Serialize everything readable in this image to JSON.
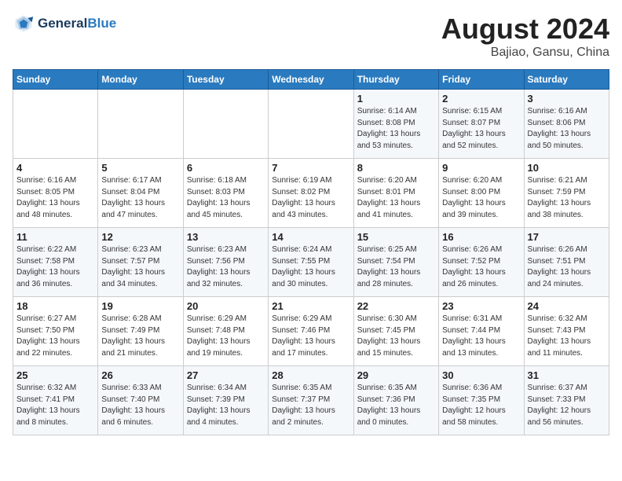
{
  "header": {
    "logo_line1": "General",
    "logo_line2": "Blue",
    "month": "August 2024",
    "location": "Bajiao, Gansu, China"
  },
  "weekdays": [
    "Sunday",
    "Monday",
    "Tuesday",
    "Wednesday",
    "Thursday",
    "Friday",
    "Saturday"
  ],
  "weeks": [
    [
      {
        "day": "",
        "info": ""
      },
      {
        "day": "",
        "info": ""
      },
      {
        "day": "",
        "info": ""
      },
      {
        "day": "",
        "info": ""
      },
      {
        "day": "1",
        "info": "Sunrise: 6:14 AM\nSunset: 8:08 PM\nDaylight: 13 hours\nand 53 minutes."
      },
      {
        "day": "2",
        "info": "Sunrise: 6:15 AM\nSunset: 8:07 PM\nDaylight: 13 hours\nand 52 minutes."
      },
      {
        "day": "3",
        "info": "Sunrise: 6:16 AM\nSunset: 8:06 PM\nDaylight: 13 hours\nand 50 minutes."
      }
    ],
    [
      {
        "day": "4",
        "info": "Sunrise: 6:16 AM\nSunset: 8:05 PM\nDaylight: 13 hours\nand 48 minutes."
      },
      {
        "day": "5",
        "info": "Sunrise: 6:17 AM\nSunset: 8:04 PM\nDaylight: 13 hours\nand 47 minutes."
      },
      {
        "day": "6",
        "info": "Sunrise: 6:18 AM\nSunset: 8:03 PM\nDaylight: 13 hours\nand 45 minutes."
      },
      {
        "day": "7",
        "info": "Sunrise: 6:19 AM\nSunset: 8:02 PM\nDaylight: 13 hours\nand 43 minutes."
      },
      {
        "day": "8",
        "info": "Sunrise: 6:20 AM\nSunset: 8:01 PM\nDaylight: 13 hours\nand 41 minutes."
      },
      {
        "day": "9",
        "info": "Sunrise: 6:20 AM\nSunset: 8:00 PM\nDaylight: 13 hours\nand 39 minutes."
      },
      {
        "day": "10",
        "info": "Sunrise: 6:21 AM\nSunset: 7:59 PM\nDaylight: 13 hours\nand 38 minutes."
      }
    ],
    [
      {
        "day": "11",
        "info": "Sunrise: 6:22 AM\nSunset: 7:58 PM\nDaylight: 13 hours\nand 36 minutes."
      },
      {
        "day": "12",
        "info": "Sunrise: 6:23 AM\nSunset: 7:57 PM\nDaylight: 13 hours\nand 34 minutes."
      },
      {
        "day": "13",
        "info": "Sunrise: 6:23 AM\nSunset: 7:56 PM\nDaylight: 13 hours\nand 32 minutes."
      },
      {
        "day": "14",
        "info": "Sunrise: 6:24 AM\nSunset: 7:55 PM\nDaylight: 13 hours\nand 30 minutes."
      },
      {
        "day": "15",
        "info": "Sunrise: 6:25 AM\nSunset: 7:54 PM\nDaylight: 13 hours\nand 28 minutes."
      },
      {
        "day": "16",
        "info": "Sunrise: 6:26 AM\nSunset: 7:52 PM\nDaylight: 13 hours\nand 26 minutes."
      },
      {
        "day": "17",
        "info": "Sunrise: 6:26 AM\nSunset: 7:51 PM\nDaylight: 13 hours\nand 24 minutes."
      }
    ],
    [
      {
        "day": "18",
        "info": "Sunrise: 6:27 AM\nSunset: 7:50 PM\nDaylight: 13 hours\nand 22 minutes."
      },
      {
        "day": "19",
        "info": "Sunrise: 6:28 AM\nSunset: 7:49 PM\nDaylight: 13 hours\nand 21 minutes."
      },
      {
        "day": "20",
        "info": "Sunrise: 6:29 AM\nSunset: 7:48 PM\nDaylight: 13 hours\nand 19 minutes."
      },
      {
        "day": "21",
        "info": "Sunrise: 6:29 AM\nSunset: 7:46 PM\nDaylight: 13 hours\nand 17 minutes."
      },
      {
        "day": "22",
        "info": "Sunrise: 6:30 AM\nSunset: 7:45 PM\nDaylight: 13 hours\nand 15 minutes."
      },
      {
        "day": "23",
        "info": "Sunrise: 6:31 AM\nSunset: 7:44 PM\nDaylight: 13 hours\nand 13 minutes."
      },
      {
        "day": "24",
        "info": "Sunrise: 6:32 AM\nSunset: 7:43 PM\nDaylight: 13 hours\nand 11 minutes."
      }
    ],
    [
      {
        "day": "25",
        "info": "Sunrise: 6:32 AM\nSunset: 7:41 PM\nDaylight: 13 hours\nand 8 minutes."
      },
      {
        "day": "26",
        "info": "Sunrise: 6:33 AM\nSunset: 7:40 PM\nDaylight: 13 hours\nand 6 minutes."
      },
      {
        "day": "27",
        "info": "Sunrise: 6:34 AM\nSunset: 7:39 PM\nDaylight: 13 hours\nand 4 minutes."
      },
      {
        "day": "28",
        "info": "Sunrise: 6:35 AM\nSunset: 7:37 PM\nDaylight: 13 hours\nand 2 minutes."
      },
      {
        "day": "29",
        "info": "Sunrise: 6:35 AM\nSunset: 7:36 PM\nDaylight: 13 hours\nand 0 minutes."
      },
      {
        "day": "30",
        "info": "Sunrise: 6:36 AM\nSunset: 7:35 PM\nDaylight: 12 hours\nand 58 minutes."
      },
      {
        "day": "31",
        "info": "Sunrise: 6:37 AM\nSunset: 7:33 PM\nDaylight: 12 hours\nand 56 minutes."
      }
    ]
  ]
}
